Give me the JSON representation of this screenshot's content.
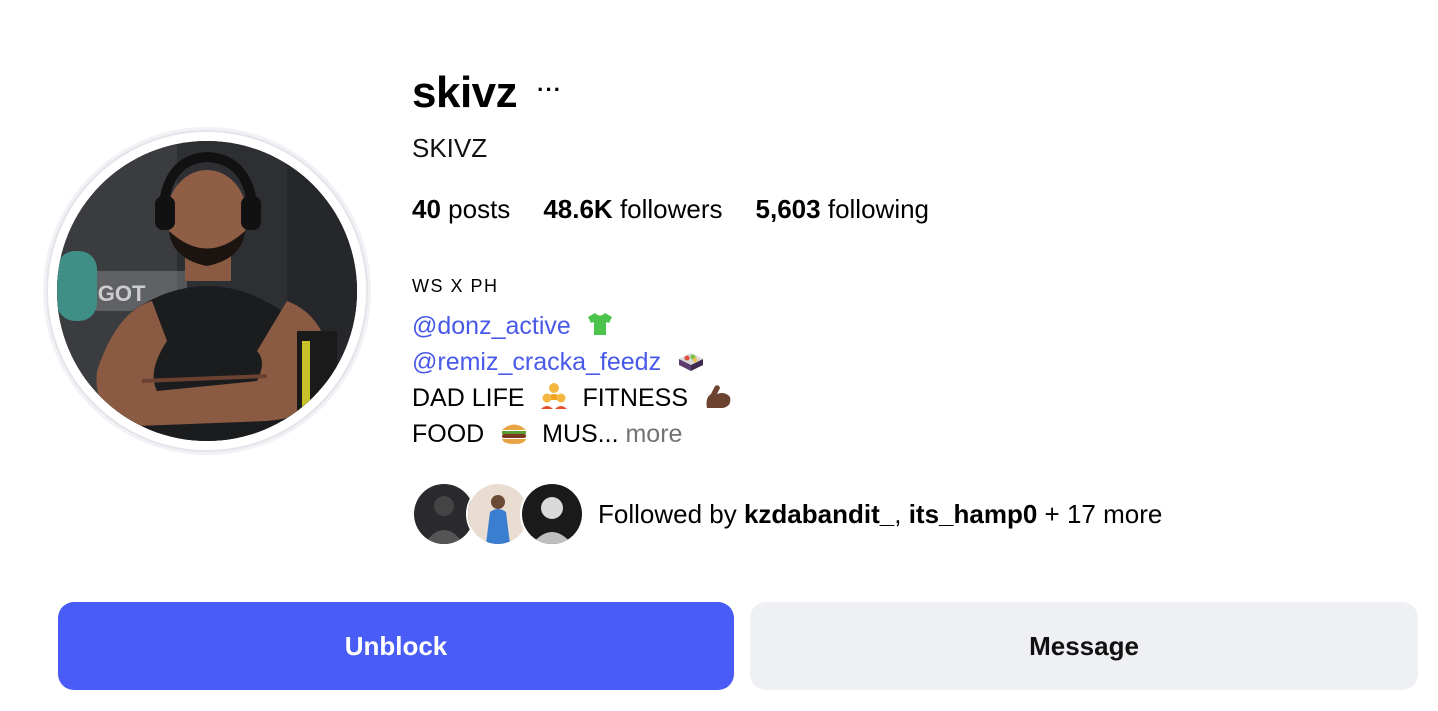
{
  "profile": {
    "username": "skivz",
    "more_icon": "···",
    "full_name": "SKIVZ"
  },
  "stats": {
    "posts_count": "40",
    "posts_label": "posts",
    "followers_count": "48.6K",
    "followers_label": "followers",
    "following_count": "5,603",
    "following_label": "following"
  },
  "bio": {
    "tagline": "WS X PH",
    "mention_1": "@donz_active",
    "mention_2": "@remiz_cracka_feedz",
    "line_3a": "DAD LIFE",
    "line_3b": "FITNESS",
    "line_4a": "FOOD",
    "line_4b": "MUS...",
    "more_label": "more",
    "emojis": [
      "shirt-icon",
      "bento-box-icon",
      "family-icon",
      "flexed-biceps-icon",
      "burger-icon"
    ]
  },
  "followed_by": {
    "prefix": "Followed by",
    "user_1": "kzdabandit_",
    "separator": ",",
    "user_2": "its_hamp0",
    "suffix": "+ 17 more"
  },
  "actions": {
    "unblock_label": "Unblock",
    "message_label": "Message"
  },
  "colors": {
    "accent": "#4a5cf6",
    "mention": "#4a5ae8",
    "secondary_button": "#eff0f4",
    "muted": "#737373"
  }
}
